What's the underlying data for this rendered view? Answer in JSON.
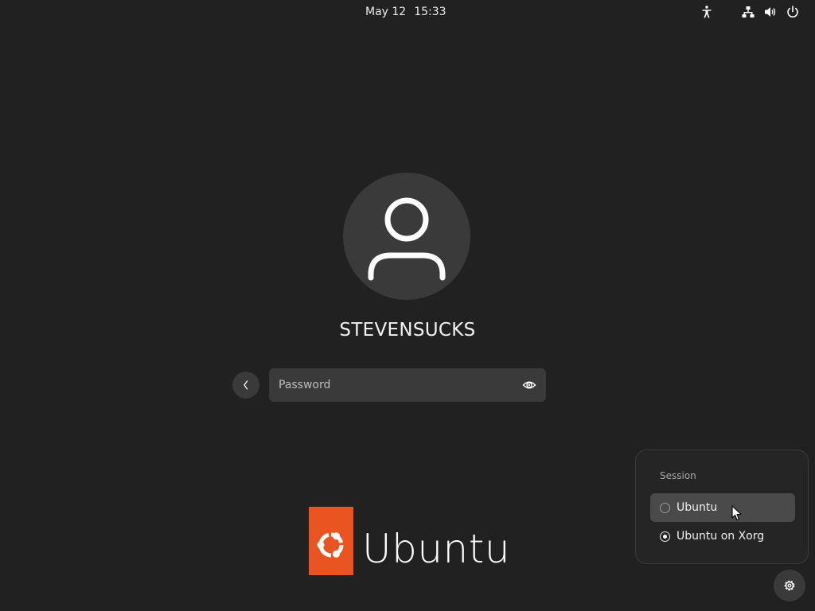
{
  "topbar": {
    "date": "May 12",
    "time": "15:33",
    "icons": [
      "accessibility-icon",
      "network-icon",
      "volume-icon",
      "power-icon"
    ]
  },
  "user": {
    "username": "STEVENSUCKS"
  },
  "password": {
    "placeholder": "Password",
    "value": ""
  },
  "branding": {
    "wordmark": "Ubuntu",
    "accent": "#e95420"
  },
  "session": {
    "heading": "Session",
    "options": [
      {
        "label": "Ubuntu",
        "selected": false,
        "hovered": true
      },
      {
        "label": "Ubuntu on Xorg",
        "selected": true,
        "hovered": false
      }
    ]
  },
  "colors": {
    "background": "#212121",
    "surface": "#3a3a3a",
    "popover": "#252525",
    "hover": "#4a4a4a"
  }
}
